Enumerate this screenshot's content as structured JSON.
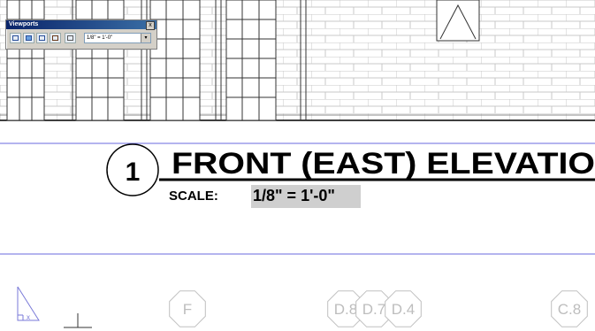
{
  "toolbar": {
    "title": "Viewports",
    "close_glyph": "x",
    "scale_value": "1/8\" = 1'-0\"",
    "dropdown_glyph": "▾",
    "buttons": [
      "single-viewport-icon",
      "viewport-dialog-icon",
      "polygonal-viewport-icon",
      "convert-object-icon",
      "clip-viewport-icon"
    ]
  },
  "drawing": {
    "callout_number": "1",
    "title": "FRONT (EAST) ELEVATIO",
    "scale_label": "SCALE:",
    "scale_value": "1/8\" = 1'-0\"",
    "grid_bubbles": [
      "F",
      "D.8",
      "D.7",
      "D.4",
      "C.8"
    ],
    "colors": {
      "brick_line": "#c8c8c8",
      "frame_line": "#000000",
      "blue_line": "#6a6adf",
      "bubble_line": "#c0c0c0",
      "selection_highlight": "#cfcfcf"
    }
  }
}
